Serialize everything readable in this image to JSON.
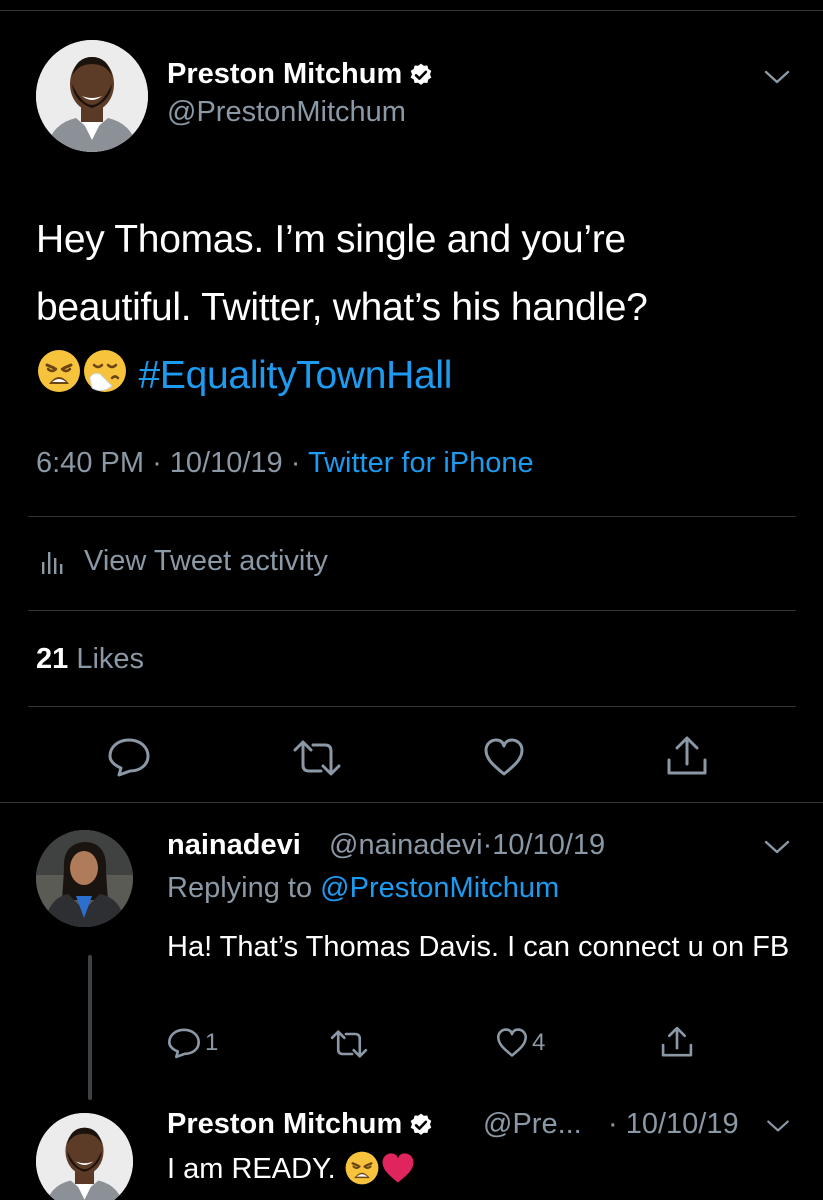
{
  "main_tweet": {
    "author_name": "Preston Mitchum",
    "author_handle": "@PrestonMitchum",
    "text_line1": "Hey Thomas. I’m single and you’re",
    "text_line2": "beautiful. Twitter, what’s his handle?",
    "emojis": [
      "weary-face",
      "sneezing-face"
    ],
    "hashtag": "#EqualityTownHall",
    "time": "6:40 PM",
    "date": "10/10/19",
    "separator": "·",
    "source": "Twitter for iPhone",
    "activity_label": "View Tweet activity",
    "likes_count": "21",
    "likes_label": "Likes"
  },
  "reply": {
    "author_name": "nainadevi",
    "author_handle": "@nainadevi",
    "date": "10/10/19",
    "replying_to_label": "Replying to",
    "replying_to_handle": "@PrestonMitchum",
    "text": "Ha! That’s Thomas Davis. I can connect u on FB",
    "reply_count": "1",
    "like_count": "4"
  },
  "bottom_tweet": {
    "author_name": "Preston Mitchum",
    "author_handle": "@Pre...",
    "date": "10/10/19",
    "text": "I am READY.",
    "emojis": [
      "weary-face",
      "red-heart"
    ]
  },
  "colors": {
    "background": "#000000",
    "accent": "#1d9bf0",
    "muted": "#8b98a5",
    "divider": "#2f3336"
  }
}
